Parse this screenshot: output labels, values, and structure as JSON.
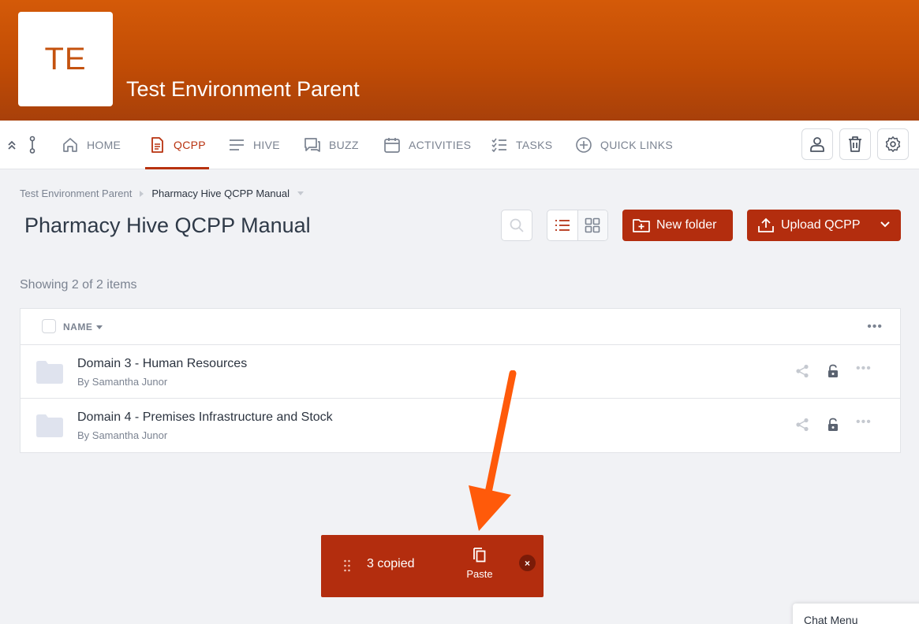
{
  "org": {
    "logo_initials": "TE",
    "title": "Test Environment Parent"
  },
  "nav": {
    "items": [
      {
        "label": "HOME",
        "icon": "home-icon"
      },
      {
        "label": "QCPP",
        "icon": "document-icon",
        "active": true
      },
      {
        "label": "HIVE",
        "icon": "lines-icon"
      },
      {
        "label": "BUZZ",
        "icon": "chat-icon"
      },
      {
        "label": "ACTIVITIES",
        "icon": "calendar-icon"
      },
      {
        "label": "TASKS",
        "icon": "checklist-icon"
      },
      {
        "label": "QUICK LINKS",
        "icon": "plus-circle-icon"
      }
    ],
    "right_buttons": [
      "user-icon",
      "trash-icon",
      "gear-icon"
    ]
  },
  "breadcrumb": {
    "parent": "Test Environment Parent",
    "current": "Pharmacy Hive QCPP Manual"
  },
  "page": {
    "title": "Pharmacy Hive QCPP Manual"
  },
  "toolbar": {
    "new_folder_label": "New folder",
    "upload_label": "Upload QCPP"
  },
  "list": {
    "count_text": "Showing 2 of 2 items",
    "column_name": "NAME",
    "rows": [
      {
        "name": "Domain 3 - Human Resources",
        "by": "By Samantha Junor"
      },
      {
        "name": "Domain 4 - Premises Infrastructure and Stock",
        "by": "By Samantha Junor"
      }
    ]
  },
  "clipboard": {
    "count_text": "3 copied",
    "paste_label": "Paste",
    "close_label": "×"
  },
  "chat": {
    "label": "Chat Menu"
  },
  "colors": {
    "brand_orange": "#d45a08",
    "accent_red": "#b32d0e",
    "annotation_arrow": "#ff5a0a"
  }
}
